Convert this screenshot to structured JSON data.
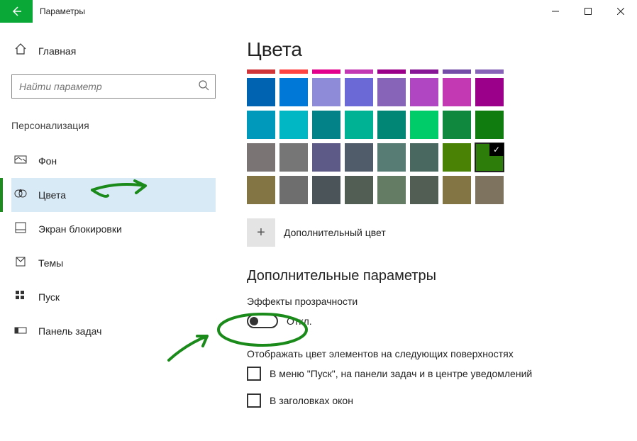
{
  "window": {
    "title": "Параметры"
  },
  "sidebar": {
    "home": "Главная",
    "search_placeholder": "Найти параметр",
    "section": "Персонализация",
    "items": [
      {
        "label": "Фон"
      },
      {
        "label": "Цвета",
        "active": true
      },
      {
        "label": "Экран блокировки"
      },
      {
        "label": "Темы"
      },
      {
        "label": "Пуск"
      },
      {
        "label": "Панель задач"
      }
    ]
  },
  "main": {
    "title": "Цвета",
    "custom_color": "Дополнительный цвет",
    "more_options": "Дополнительные параметры",
    "transparency": {
      "label": "Эффекты прозрачности",
      "state": "Откл."
    },
    "show_accent": {
      "label": "Отображать цвет элементов на следующих поверхностях",
      "opt1": "В меню \"Пуск\", на панели задач и в центре уведомлений",
      "opt2": "В заголовках окон"
    },
    "swatches": {
      "thin_row": [
        "#d13438",
        "#ff4343",
        "#e3008c",
        "#c239b3",
        "#9a0089",
        "#881798",
        "#744da9",
        "#8764b8"
      ],
      "rows": [
        [
          "#0063b1",
          "#0078d7",
          "#8e8cd8",
          "#6b69d6",
          "#8764b8",
          "#b146c2",
          "#c239b3",
          "#9a0089"
        ],
        [
          "#0099bc",
          "#00b7c3",
          "#038387",
          "#00b294",
          "#018574",
          "#00cc6a",
          "#10893e",
          "#107c10"
        ],
        [
          "#7a7574",
          "#767676",
          "#5d5a88",
          "#515c6b",
          "#567c73",
          "#486860",
          "#498205",
          "#2d7d0a"
        ],
        [
          "#847545",
          "#6e6e6e",
          "#4a5459",
          "#525e54",
          "#647c64",
          "#525e54",
          "#847545",
          "#7e735f"
        ]
      ],
      "selected": [
        2,
        7
      ]
    }
  }
}
